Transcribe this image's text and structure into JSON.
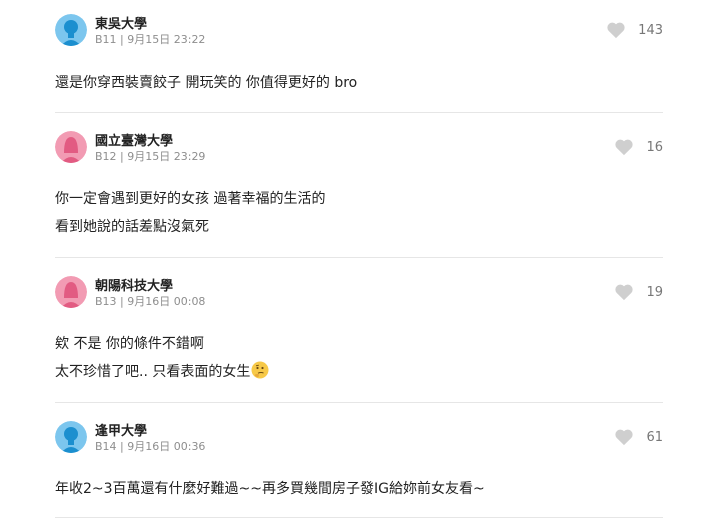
{
  "comments": [
    {
      "school": "東吳大學",
      "meta": "B11 | 9月15日 23:22",
      "likes": "143",
      "avatar": "male",
      "lines": [
        "還是你穿西裝賣餃子 開玩笑的 你值得更好的 bro"
      ]
    },
    {
      "school": "國立臺灣大學",
      "meta": "B12 | 9月15日 23:29",
      "likes": "16",
      "avatar": "female",
      "lines": [
        "你一定會遇到更好的女孩 過著幸福的生活的",
        "看到她說的話差點沒氣死"
      ]
    },
    {
      "school": "朝陽科技大學",
      "meta": "B13 | 9月16日 00:08",
      "likes": "19",
      "avatar": "female",
      "lines": [
        "欸 不是 你的條件不錯啊",
        "太不珍惜了吧.. 只看表面的女生"
      ]
    },
    {
      "school": "逢甲大學",
      "meta": "B14 | 9月16日 00:36",
      "likes": "61",
      "avatar": "male",
      "lines": [
        "年收2~3百萬還有什麼好難過~~再多買幾間房子發IG給妳前女友看~"
      ]
    }
  ],
  "colors": {
    "male_avatar_bg": "#7cc6ee",
    "male_avatar_fg": "#1b8fcf",
    "female_avatar_bg": "#f29bb3",
    "female_avatar_fg": "#e25b82",
    "heart": "#cfcfcf",
    "thinking_emoji": "#f7c948"
  },
  "icons": {
    "like": "heart-icon",
    "thinking": "thinking-face-emoji"
  }
}
